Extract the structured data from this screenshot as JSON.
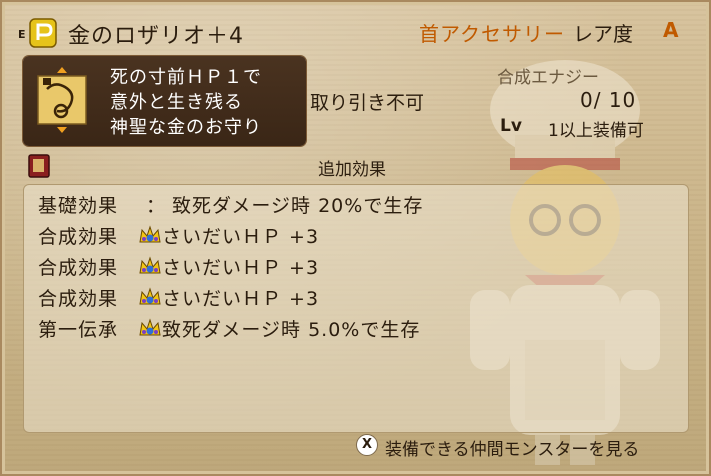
{
  "header": {
    "e_mark": "E",
    "item_name": "金のロザリオ＋4",
    "category": "首アクセサリー",
    "rarity_label": "レア度",
    "rarity_value": "A"
  },
  "description": {
    "lines": [
      "死の寸前ＨＰ１で",
      "意外と生き残る",
      "神聖な金のお守り"
    ]
  },
  "trade": {
    "label": "取り引き不可"
  },
  "synthesis": {
    "label": "合成エナジー",
    "value": "0/ 10"
  },
  "level": {
    "label": "Lv",
    "value": "1以上装備可"
  },
  "effects": {
    "heading": "追加効果",
    "rows": [
      {
        "label": "基礎効果",
        "colon": "：",
        "text": "致死ダメージ時 20%で生存",
        "icon": ""
      },
      {
        "label": "合成効果",
        "text": "さいだいＨＰ +3",
        "icon": "crown-gem-icon"
      },
      {
        "label": "合成効果",
        "text": "さいだいＨＰ +3",
        "icon": "crown-gem-icon"
      },
      {
        "label": "合成効果",
        "text": "さいだいＨＰ +3",
        "icon": "crown-gem-icon"
      },
      {
        "label": "第一伝承",
        "text": "致死ダメージ時 5.0%で生存",
        "icon": "crown-gem-icon"
      }
    ]
  },
  "footer": {
    "button_glyph": "X",
    "text": "装備できる仲間モンスターを見る"
  },
  "colors": {
    "accent": "#c05a00",
    "text": "#2b1d0e",
    "desc_bg": "#3a2616"
  }
}
